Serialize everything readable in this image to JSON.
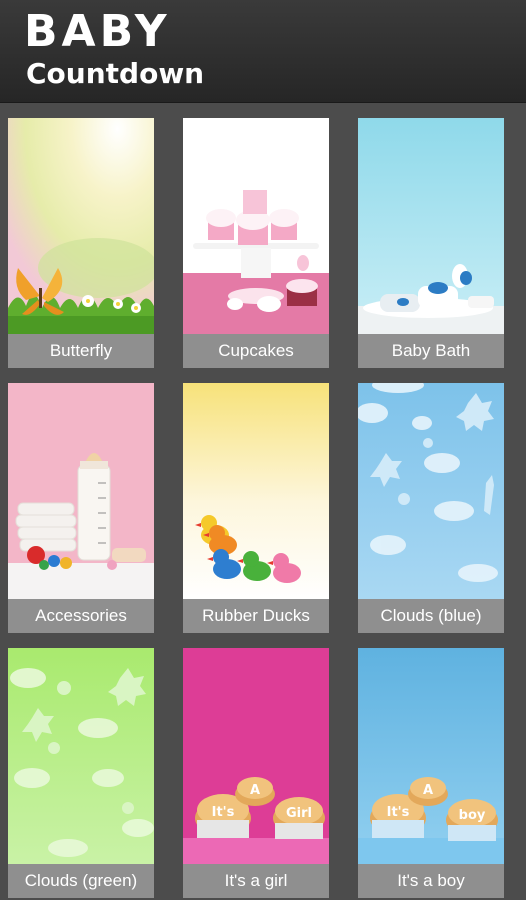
{
  "header": {
    "title": "BABY",
    "subtitle": "Countdown"
  },
  "themes": [
    {
      "id": "butterfly",
      "label": "Butterfly"
    },
    {
      "id": "cupcakes",
      "label": "Cupcakes"
    },
    {
      "id": "baby-bath",
      "label": "Baby Bath"
    },
    {
      "id": "accessories",
      "label": "Accessories"
    },
    {
      "id": "rubber-ducks",
      "label": "Rubber Ducks"
    },
    {
      "id": "clouds-blue",
      "label": "Clouds (blue)"
    },
    {
      "id": "clouds-green",
      "label": "Clouds (green)"
    },
    {
      "id": "its-a-girl",
      "label": "It's a girl",
      "cupcake_text": [
        "It's",
        "A",
        "Girl"
      ]
    },
    {
      "id": "its-a-boy",
      "label": "It's a boy",
      "cupcake_text": [
        "It's",
        "A",
        "boy"
      ]
    }
  ],
  "colors": {
    "background": "#4c4c4c",
    "header": "#2e2e2e",
    "label_bar": "#8f8f8f"
  }
}
